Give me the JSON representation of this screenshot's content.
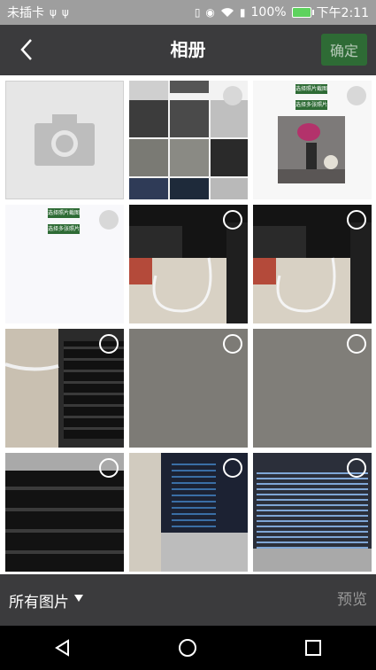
{
  "status_bar": {
    "left_text": "未插卡",
    "battery_percent": "100%",
    "time": "下午2:11",
    "icons": [
      "usb-icon",
      "usb-icon",
      "vibrate-icon",
      "eye-icon",
      "wifi-icon",
      "sim-icon",
      "battery-icon"
    ]
  },
  "header": {
    "title": "相册",
    "confirm_label": "确定",
    "back_icon": "chevron-left-icon"
  },
  "grid": {
    "columns": 3,
    "items": [
      {
        "type": "camera",
        "icon": "camera-icon"
      },
      {
        "type": "photo",
        "subject": "screenshot collage",
        "selected": false
      },
      {
        "type": "photo",
        "subject": "flowers in vase screenshot",
        "selected": false
      },
      {
        "type": "photo",
        "subject": "blank screenshot",
        "selected": false
      },
      {
        "type": "photo",
        "subject": "desk with keyboard and cables",
        "selected": false
      },
      {
        "type": "photo",
        "subject": "desk with keyboard and cables",
        "selected": false
      },
      {
        "type": "photo",
        "subject": "laptop keyboard with cable",
        "selected": false
      },
      {
        "type": "photo",
        "subject": "grey blurry",
        "selected": false
      },
      {
        "type": "photo",
        "subject": "grey blurry",
        "selected": false
      },
      {
        "type": "photo",
        "subject": "laptop keyboard close-up",
        "selected": false
      },
      {
        "type": "photo",
        "subject": "laptop with code editor",
        "selected": false
      },
      {
        "type": "photo",
        "subject": "laptop with code editor",
        "selected": false
      }
    ],
    "mini_buttons": [
      "选择照片截图",
      "选择多张照片"
    ]
  },
  "footer": {
    "folder_label": "所有图片",
    "preview_label": "预览"
  },
  "navigation": {
    "buttons": [
      "back-triangle-icon",
      "home-circle-icon",
      "recents-square-icon"
    ]
  },
  "colors": {
    "status_bar": "#9e9e9e",
    "app_bar": "#3b3b3d",
    "accent_green": "#2e6b35",
    "nav_bar": "#000000"
  }
}
